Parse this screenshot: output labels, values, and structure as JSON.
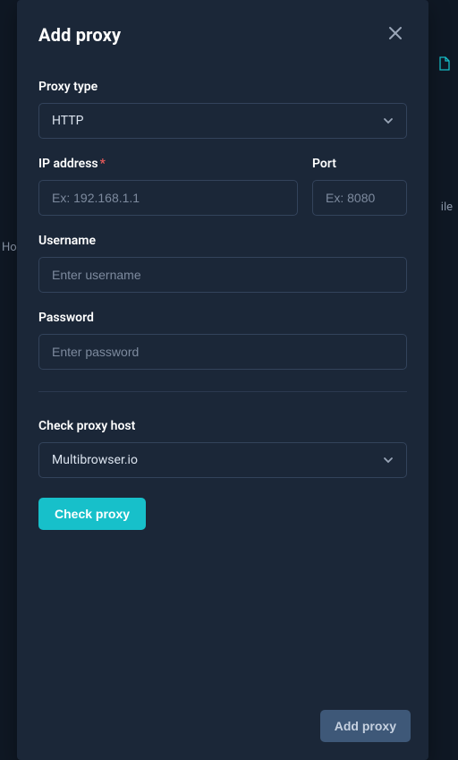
{
  "modal": {
    "title": "Add proxy",
    "footer": {
      "submit_label": "Add proxy"
    }
  },
  "form": {
    "proxy_type": {
      "label": "Proxy type",
      "value": "HTTP"
    },
    "ip": {
      "label": "IP address",
      "placeholder": "Ex: 192.168.1.1",
      "value": ""
    },
    "port": {
      "label": "Port",
      "placeholder": "Ex: 8080",
      "value": ""
    },
    "username": {
      "label": "Username",
      "placeholder": "Enter username",
      "value": ""
    },
    "password": {
      "label": "Password",
      "placeholder": "Enter password",
      "value": ""
    },
    "check_host": {
      "label": "Check proxy host",
      "value": "Multibrowser.io"
    },
    "check_button": "Check proxy"
  },
  "background": {
    "text_right": "ile",
    "text_left": "Ho"
  }
}
